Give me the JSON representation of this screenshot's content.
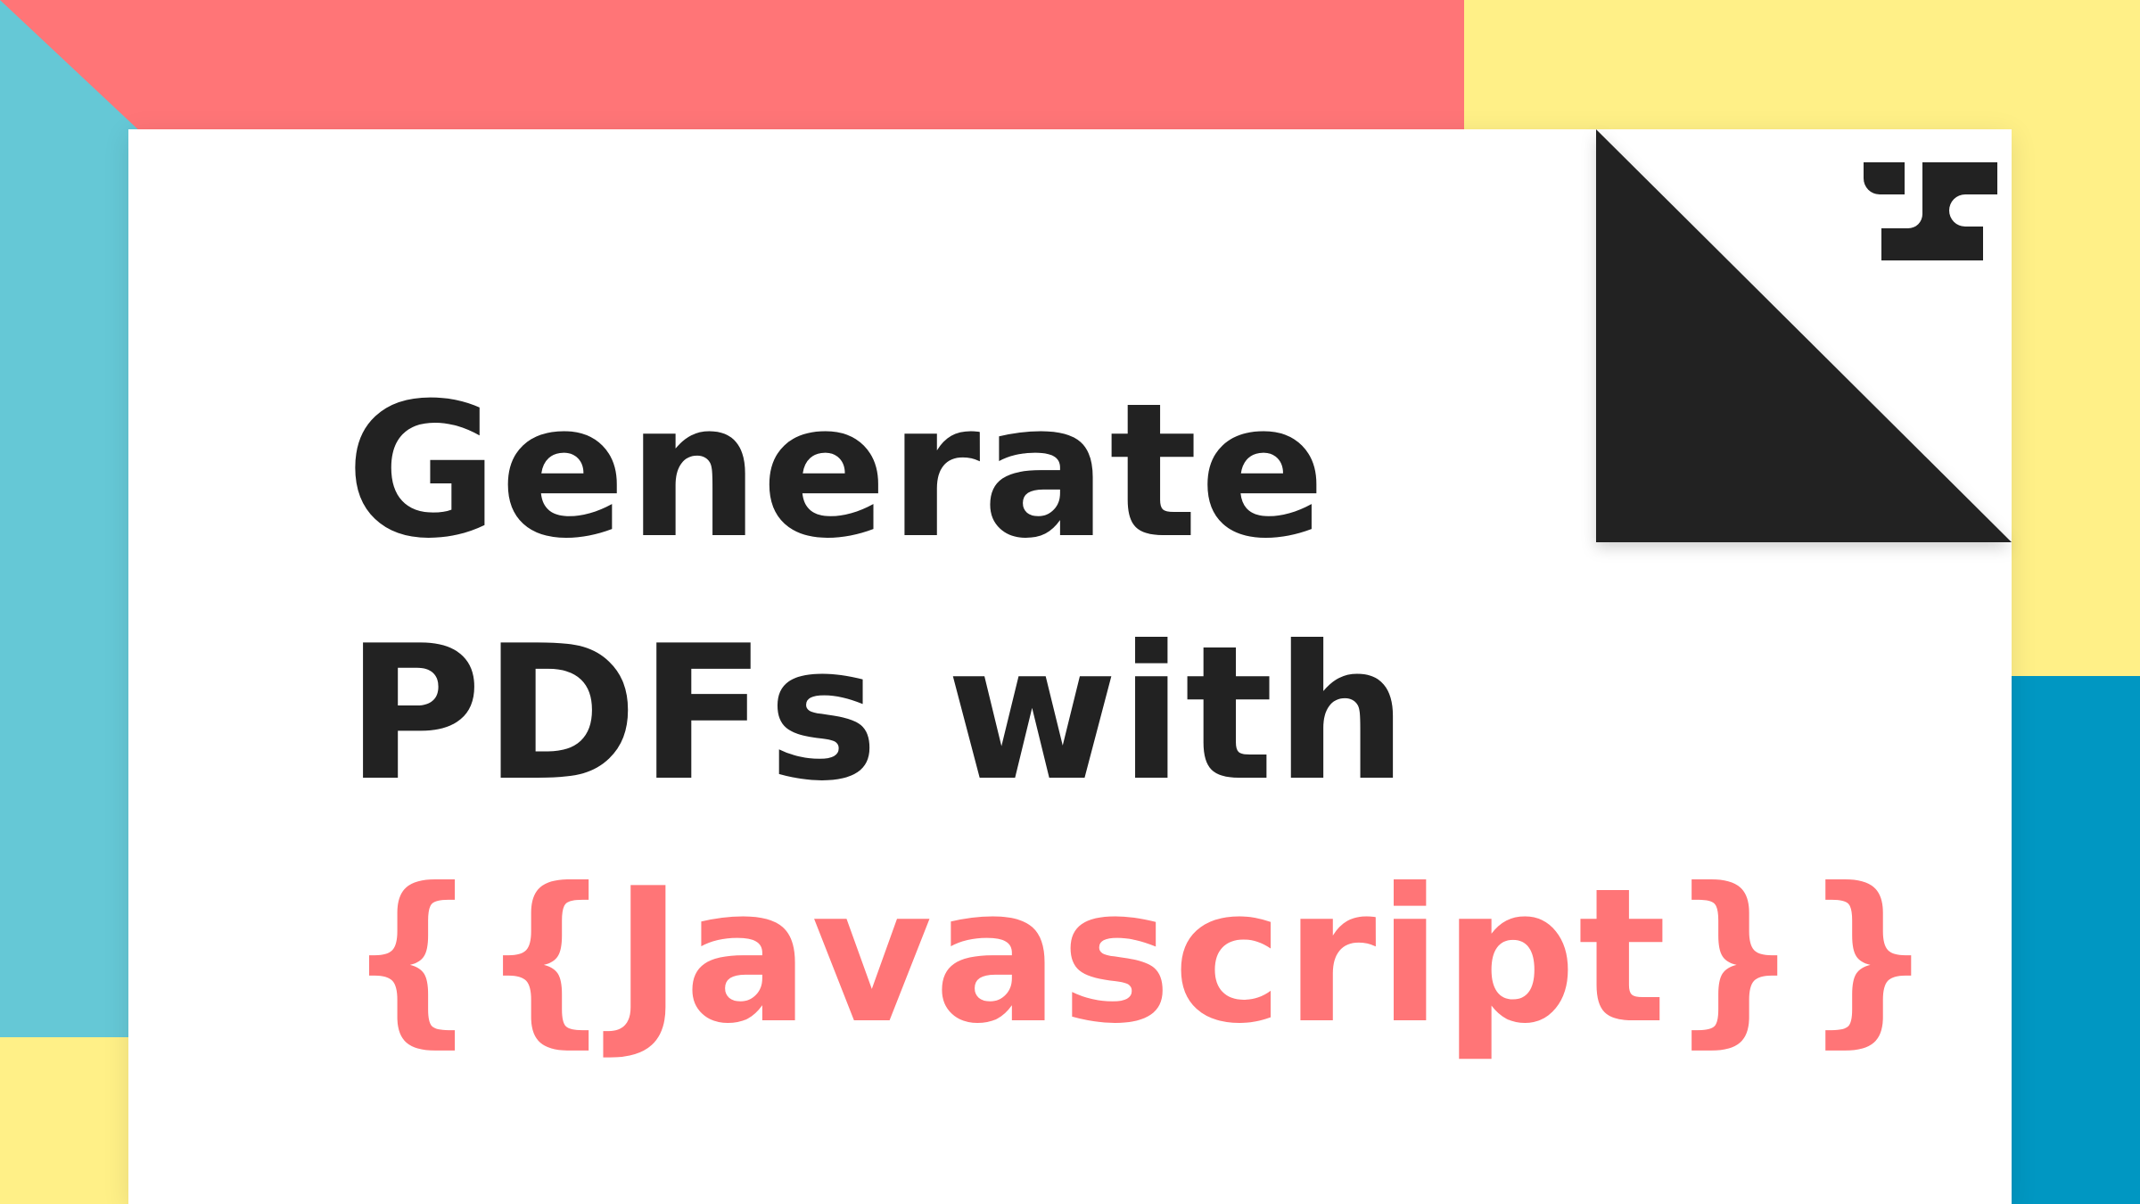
{
  "colors": {
    "coral": "#ff7577",
    "yellow": "#fff087",
    "sky": "#65c8d6",
    "ocean": "#0097c2",
    "ink": "#222222",
    "paper": "#ffffff"
  },
  "logo": {
    "icon": "brand-logo-icon"
  },
  "headline": {
    "line1": "Generate",
    "line2": "PDFs with",
    "line3": "{{Javascript}}"
  }
}
